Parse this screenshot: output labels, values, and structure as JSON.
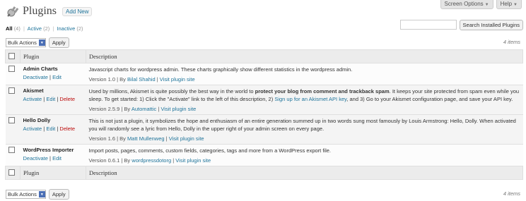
{
  "screen_options": {
    "label": "Screen Options",
    "help": "Help"
  },
  "header": {
    "title": "Plugins",
    "add_new": "Add New"
  },
  "filters": {
    "all": {
      "label": "All",
      "count": "(4)"
    },
    "active": {
      "label": "Active",
      "count": "(2)"
    },
    "inactive": {
      "label": "Inactive",
      "count": "(2)"
    },
    "sep": "|"
  },
  "search": {
    "button": "Search Installed Plugins",
    "value": ""
  },
  "bulk": {
    "label": "Bulk Actions",
    "apply": "Apply",
    "items_count": "4 items"
  },
  "table": {
    "col_plugin": "Plugin",
    "col_description": "Description",
    "by": "By",
    "visit": "Visit plugin site",
    "sep": "|",
    "rows": [
      {
        "name": "Admin Charts",
        "actions": [
          "Deactivate",
          "Edit"
        ],
        "description": "Javascript charts for wordpress admin. These charts graphically show different statistics in the wordpress admin.",
        "version": "Version 1.0",
        "author": "Bilal Shahid",
        "active": true
      },
      {
        "name": "Akismet",
        "actions": [
          "Activate",
          "Edit",
          "Delete"
        ],
        "desc_a": "Used by millions, Akismet is quite possibly the best way in the world to ",
        "desc_b": "protect your blog from comment and trackback spam",
        "desc_c": ". It keeps your site protected from spam even while you sleep. To get started: 1) Click the \"Activate\" link to the left of this description, 2) ",
        "desc_link": "Sign up for an Akismet API key",
        "desc_d": ", and 3) Go to your Akismet configuration page, and save your API key.",
        "version": "Version 2.5.9",
        "author": "Automattic",
        "active": false
      },
      {
        "name": "Hello Dolly",
        "actions": [
          "Activate",
          "Edit",
          "Delete"
        ],
        "description": "This is not just a plugin, it symbolizes the hope and enthusiasm of an entire generation summed up in two words sung most famously by Louis Armstrong: Hello, Dolly. When activated you will randomly see a lyric from Hello, Dolly in the upper right of your admin screen on every page.",
        "version": "Version 1.6",
        "author": "Matt Mullenweg",
        "active": false
      },
      {
        "name": "WordPress Importer",
        "actions": [
          "Deactivate",
          "Edit"
        ],
        "description": "Import posts, pages, comments, custom fields, categories, tags and more from a WordPress export file.",
        "version": "Version 0.6.1",
        "author": "wordpressdotorg",
        "active": true
      }
    ]
  }
}
